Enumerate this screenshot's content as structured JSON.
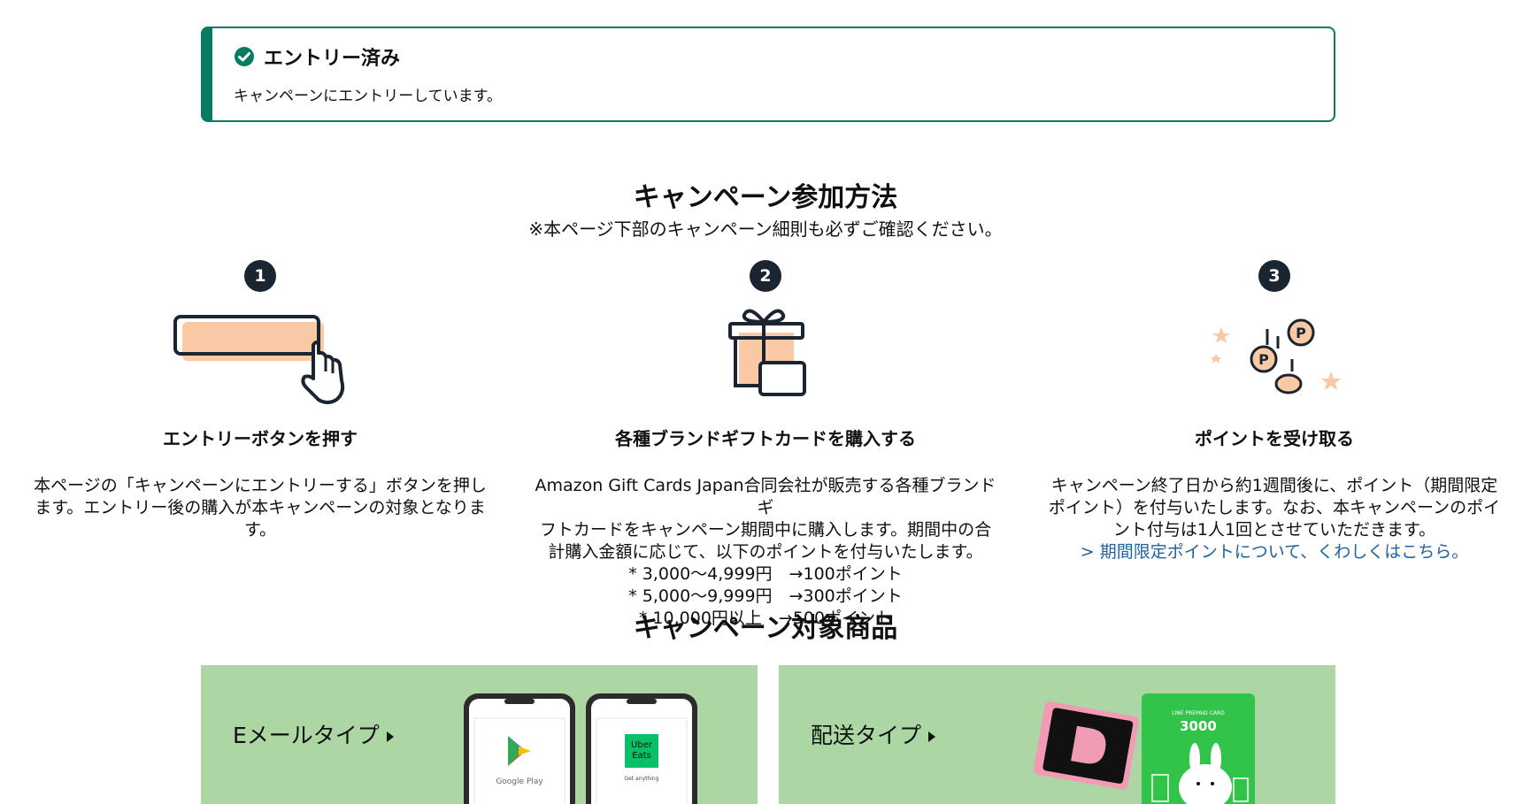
{
  "entry": {
    "title": "エントリー済み",
    "description": "キャンペーンにエントリーしています。"
  },
  "howto": {
    "title": "キャンペーン参加方法",
    "note": "※本ページ下部のキャンペーン細則も必ずご確認ください。"
  },
  "steps": [
    {
      "number": "1",
      "title": "エントリーボタンを押す",
      "lines": [
        "本ページの「キャンペーンにエントリーする」ボタンを押し",
        "ます。エントリー後の購入が本キャンペーンの対象となりま",
        "す。"
      ]
    },
    {
      "number": "2",
      "title": "各種ブランドギフトカードを購入する",
      "lines": [
        "Amazon Gift Cards Japan合同会社が販売する各種ブランドギ",
        "フトカードをキャンペーン期間中に購入します。期間中の合",
        "計購入金額に応じて、以下のポイントを付与いたします。"
      ],
      "tiers": [
        "* 3,000〜4,999円　→100ポイント",
        "* 5,000〜9,999円　→300ポイント",
        "* 10,000円以上　→500ポイント"
      ]
    },
    {
      "number": "3",
      "title": "ポイントを受け取る",
      "lines": [
        "キャンペーン終了日から約1週間後に、ポイント（期間限定",
        "ポイント）を付与いたします。なお、本キャンペーンのポイ",
        "ント付与は1人1回とさせていただきます。"
      ],
      "link": "> 期間限定ポイントについて、くわしくはこちら。"
    }
  ],
  "products": {
    "title": "キャンペーン対象商品",
    "cards": [
      {
        "label": "Eメールタイプ",
        "phones": [
          {
            "brand": "Google Play"
          },
          {
            "brand_lines": [
              "Uber",
              "Eats"
            ],
            "caption": "Get anything"
          }
        ]
      },
      {
        "label": "配送タイプ",
        "gift_card": {
          "amount": "3000",
          "header": "LINE PREPAID CARD"
        }
      }
    ]
  },
  "colors": {
    "success": "#067d62",
    "accent_peach": "#f8c9a4",
    "dark": "#1b2431",
    "banner_green": "#acd6a3",
    "link": "#2162a1"
  }
}
